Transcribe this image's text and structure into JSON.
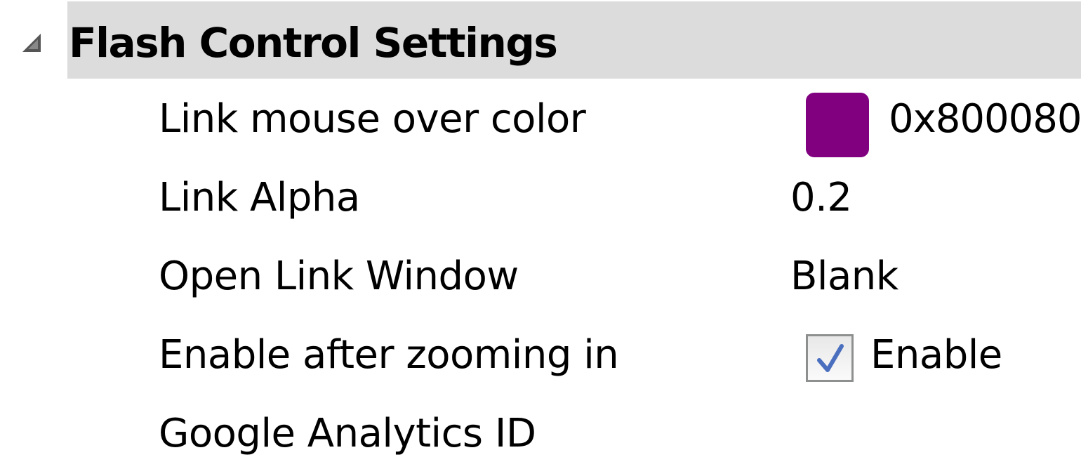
{
  "section": {
    "title": "Flash Control Settings",
    "collapse_icon": "collapse-triangle-icon"
  },
  "rows": [
    {
      "label": "Link mouse over color",
      "value": "0x800080",
      "swatch_color": "#800080"
    },
    {
      "label": "Link Alpha",
      "value": "0.2"
    },
    {
      "label": "Open Link Window",
      "value": "Blank"
    },
    {
      "label": "Enable after zooming in",
      "checkbox_checked": true,
      "checkbox_label": "Enable"
    },
    {
      "label": "Google Analytics ID",
      "value": ""
    }
  ],
  "colors": {
    "header_bg": "#dcdcdc",
    "check_mark": "#4a6fbf"
  }
}
